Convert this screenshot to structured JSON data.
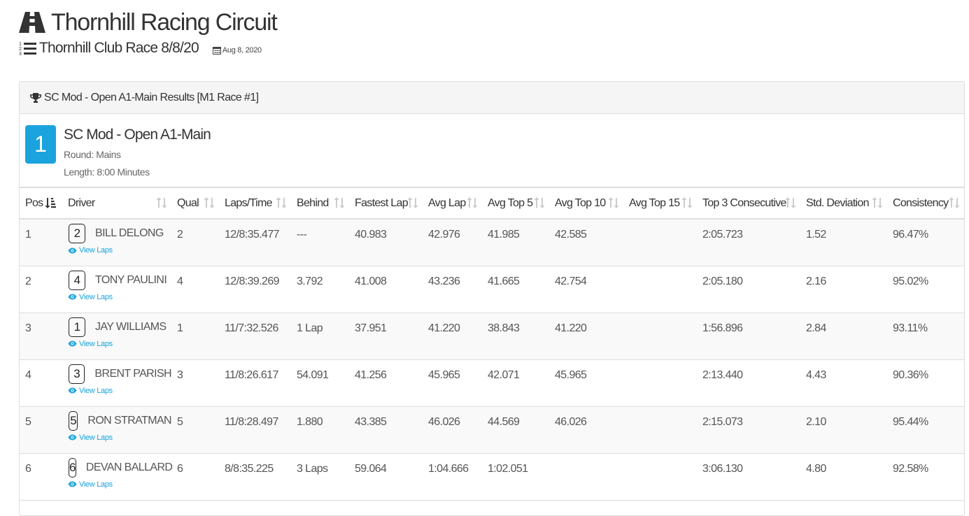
{
  "header": {
    "track_name": "Thornhill Racing Circuit",
    "event_name": "Thornhill Club Race 8/8/20",
    "event_date": "Aug 8, 2020"
  },
  "panel": {
    "heading": "SC Mod - Open A1-Main Results [M1 Race #1]",
    "race_number": "1",
    "race_name": "SC Mod - Open A1-Main",
    "round": "Round: Mains",
    "length": "Length: 8:00 Minutes"
  },
  "table": {
    "columns": [
      {
        "label": "Pos",
        "sort": "active"
      },
      {
        "label": "Driver",
        "sort": "inactive"
      },
      {
        "label": "Qual",
        "sort": "inactive"
      },
      {
        "label": "Laps/Time",
        "sort": "inactive"
      },
      {
        "label": "Behind",
        "sort": "inactive"
      },
      {
        "label": "Fastest Lap",
        "sort": "inactive"
      },
      {
        "label": "Avg Lap",
        "sort": "inactive"
      },
      {
        "label": "Avg Top 5",
        "sort": "inactive"
      },
      {
        "label": "Avg Top 10",
        "sort": "inactive"
      },
      {
        "label": "Avg Top 15",
        "sort": "inactive"
      },
      {
        "label": "Top 3 Consecutive",
        "sort": "inactive"
      },
      {
        "label": "Std. Deviation",
        "sort": "inactive"
      },
      {
        "label": "Consistency",
        "sort": "inactive"
      }
    ],
    "view_laps_label": "View Laps",
    "rows": [
      {
        "pos": "1",
        "car": "2",
        "driver": "BILL DELONG",
        "qual": "2",
        "laps_time": "12/8:35.477",
        "behind": "---",
        "fastest": "40.983",
        "avg_lap": "42.976",
        "avg_top5": "41.985",
        "avg_top10": "42.585",
        "avg_top15": "",
        "top3_consec": "2:05.723",
        "std_dev": "1.52",
        "consistency": "96.47%"
      },
      {
        "pos": "2",
        "car": "4",
        "driver": "TONY PAULINI",
        "qual": "4",
        "laps_time": "12/8:39.269",
        "behind": "3.792",
        "fastest": "41.008",
        "avg_lap": "43.236",
        "avg_top5": "41.665",
        "avg_top10": "42.754",
        "avg_top15": "",
        "top3_consec": "2:05.180",
        "std_dev": "2.16",
        "consistency": "95.02%"
      },
      {
        "pos": "3",
        "car": "1",
        "driver": "JAY WILLIAMS",
        "qual": "1",
        "laps_time": "11/7:32.526",
        "behind": "1 Lap",
        "fastest": "37.951",
        "avg_lap": "41.220",
        "avg_top5": "38.843",
        "avg_top10": "41.220",
        "avg_top15": "",
        "top3_consec": "1:56.896",
        "std_dev": "2.84",
        "consistency": "93.11%"
      },
      {
        "pos": "4",
        "car": "3",
        "driver": "BRENT PARISH",
        "qual": "3",
        "laps_time": "11/8:26.617",
        "behind": "54.091",
        "fastest": "41.256",
        "avg_lap": "45.965",
        "avg_top5": "42.071",
        "avg_top10": "45.965",
        "avg_top15": "",
        "top3_consec": "2:13.440",
        "std_dev": "4.43",
        "consistency": "90.36%"
      },
      {
        "pos": "5",
        "car": "5",
        "driver": "RON STRATMAN",
        "qual": "5",
        "laps_time": "11/8:28.497",
        "behind": "1.880",
        "fastest": "43.385",
        "avg_lap": "46.026",
        "avg_top5": "44.569",
        "avg_top10": "46.026",
        "avg_top15": "",
        "top3_consec": "2:15.073",
        "std_dev": "2.10",
        "consistency": "95.44%"
      },
      {
        "pos": "6",
        "car": "6",
        "driver": "DEVAN BALLARD",
        "qual": "6",
        "laps_time": "8/8:35.225",
        "behind": "3 Laps",
        "fastest": "59.064",
        "avg_lap": "1:04.666",
        "avg_top5": "1:02.051",
        "avg_top10": "",
        "avg_top15": "",
        "top3_consec": "3:06.130",
        "std_dev": "4.80",
        "consistency": "92.58%"
      }
    ]
  },
  "colors": {
    "accent": "#1aa3dd",
    "heading_bg": "#f5f5f5",
    "stripe_bg": "#f9f9f9",
    "border": "#dddddd",
    "sort_icon": "#cccccc"
  },
  "icons": {
    "track": "road-icon",
    "event": "list-ol-icon",
    "date": "calendar-icon",
    "heading": "trophy-icon",
    "view_laps": "eye-icon",
    "sort_active": "sort-amount-asc-icon",
    "sort_inactive": "sort-icon"
  }
}
